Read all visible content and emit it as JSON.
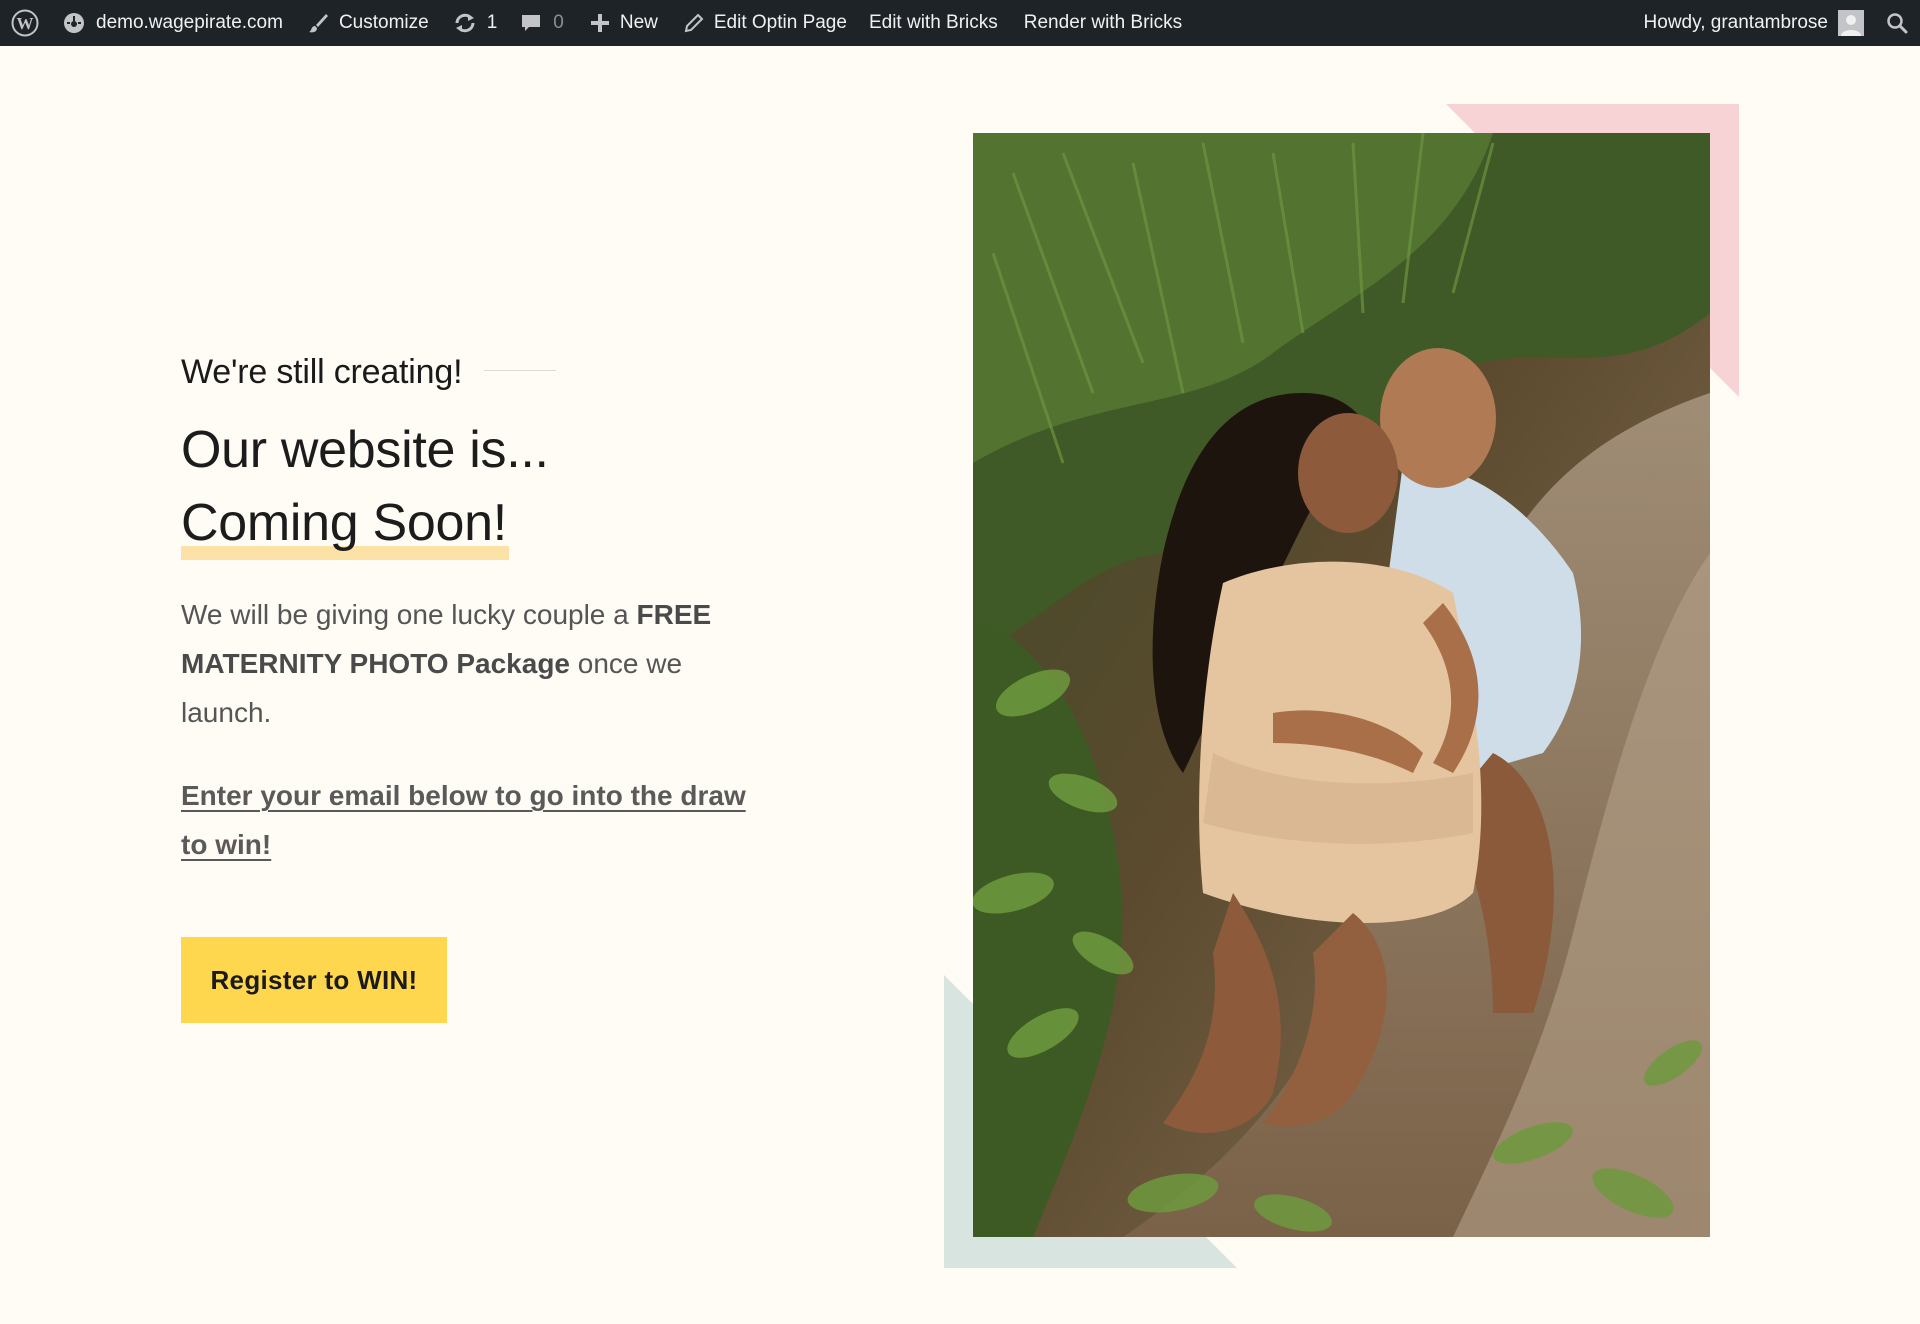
{
  "adminbar": {
    "site_name": "demo.wagepirate.com",
    "customize_label": "Customize",
    "updates_count": "1",
    "comments_count": "0",
    "new_label": "New",
    "edit_page_label": "Edit Optin Page",
    "edit_bricks_label": "Edit with Bricks",
    "render_bricks_label": "Render with Bricks",
    "howdy_label": "Howdy, grantambrose",
    "icons": [
      "wordpress-logo-icon",
      "dashboard-icon",
      "paintbrush-icon",
      "updates-icon",
      "comment-icon",
      "plus-icon",
      "pencil-icon",
      "avatar-icon",
      "search-icon"
    ]
  },
  "hero": {
    "kicker": "We're still creating!",
    "headline_line1": "Our website is...",
    "headline_line2": "Coming Soon!",
    "body_part1": "We will be giving one lucky couple a ",
    "body_bold": "FREE MATERNITY PHOTO Package",
    "body_part2": " once we launch.",
    "cta_link": "Enter your email below to go into the draw to win!",
    "button_label": "Register to WIN!"
  },
  "colors": {
    "page_bg": "#fffcf6",
    "adminbar_bg": "#1d2327",
    "button_bg": "#ffd74f",
    "highlight": "#fde2a8",
    "accent_pink": "#f7d3d6",
    "accent_green": "#d8e4df"
  }
}
